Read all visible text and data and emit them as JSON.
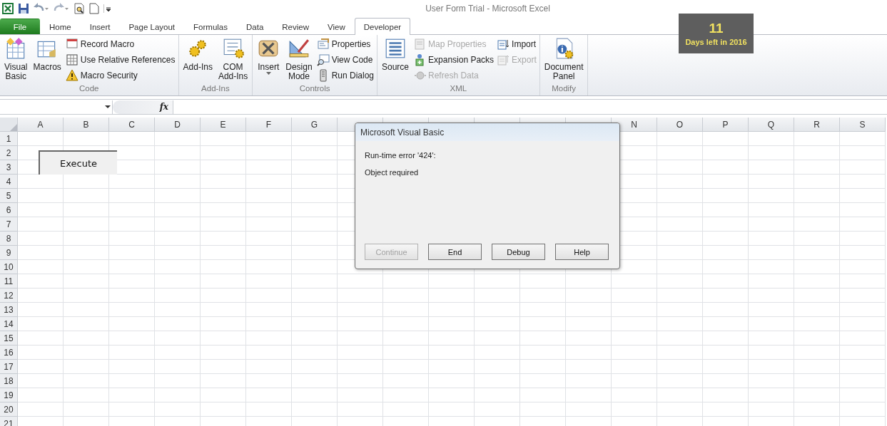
{
  "window": {
    "title": "User Form Trial  -  Microsoft Excel"
  },
  "tabs": [
    {
      "label": "File",
      "kind": "file",
      "selected": false
    },
    {
      "label": "Home",
      "kind": "tab",
      "selected": false
    },
    {
      "label": "Insert",
      "kind": "tab",
      "selected": false
    },
    {
      "label": "Page Layout",
      "kind": "tab",
      "selected": false
    },
    {
      "label": "Formulas",
      "kind": "tab",
      "selected": false
    },
    {
      "label": "Data",
      "kind": "tab",
      "selected": false
    },
    {
      "label": "Review",
      "kind": "tab",
      "selected": false
    },
    {
      "label": "View",
      "kind": "tab",
      "selected": false
    },
    {
      "label": "Developer",
      "kind": "tab",
      "selected": true
    }
  ],
  "ribbon": [
    {
      "label": "Code",
      "items": [
        {
          "kind": "large",
          "label": "Visual\nBasic",
          "disabled": false
        },
        {
          "kind": "large",
          "label": "Macros",
          "disabled": false
        },
        {
          "kind": "small",
          "label": "Record Macro",
          "disabled": false
        },
        {
          "kind": "small",
          "label": "Use Relative References",
          "disabled": false
        },
        {
          "kind": "small",
          "label": "Macro Security",
          "disabled": false
        }
      ]
    },
    {
      "label": "Add-Ins",
      "items": [
        {
          "kind": "large",
          "label": "Add-Ins",
          "disabled": false
        },
        {
          "kind": "large",
          "label": "COM\nAdd-Ins",
          "disabled": false
        }
      ]
    },
    {
      "label": "Controls",
      "items": [
        {
          "kind": "menu",
          "label": "Insert",
          "disabled": false
        },
        {
          "kind": "large",
          "label": "Design\nMode",
          "disabled": false
        },
        {
          "kind": "small",
          "label": "Properties",
          "disabled": false
        },
        {
          "kind": "small",
          "label": "View Code",
          "disabled": false
        },
        {
          "kind": "small",
          "label": "Run Dialog",
          "disabled": false
        }
      ]
    },
    {
      "label": "XML",
      "items": [
        {
          "kind": "large",
          "label": "Source",
          "disabled": false
        },
        {
          "kind": "small",
          "label": "Map Properties",
          "disabled": true
        },
        {
          "kind": "small",
          "label": "Expansion Packs",
          "disabled": false
        },
        {
          "kind": "small",
          "label": "Refresh Data",
          "disabled": true
        },
        {
          "kind": "small",
          "label": "Import",
          "disabled": false
        },
        {
          "kind": "small",
          "label": "Export",
          "disabled": true
        }
      ]
    },
    {
      "label": "Modify",
      "items": [
        {
          "kind": "large",
          "label": "Document\nPanel",
          "disabled": false
        }
      ]
    }
  ],
  "overlay_badge": {
    "number": "11",
    "caption": "Days left in 2016"
  },
  "formula_bar": {
    "function_label": "fx"
  },
  "sheet": {
    "columns": [
      {
        "kind": "label",
        "label": "A"
      },
      {
        "kind": "label",
        "label": "B"
      },
      {
        "kind": "label",
        "label": "C"
      },
      {
        "kind": "label",
        "label": "D"
      },
      {
        "kind": "label",
        "label": "E"
      },
      {
        "kind": "label",
        "label": "F"
      },
      {
        "kind": "label",
        "label": "G"
      },
      {
        "kind": "covered"
      },
      {
        "kind": "covered"
      },
      {
        "kind": "covered"
      },
      {
        "kind": "covered"
      },
      {
        "kind": "covered"
      },
      {
        "kind": "covered"
      },
      {
        "kind": "label",
        "label": "N"
      },
      {
        "kind": "label",
        "label": "O"
      },
      {
        "kind": "label",
        "label": "P"
      },
      {
        "kind": "label",
        "label": "Q"
      },
      {
        "kind": "label",
        "label": "R"
      },
      {
        "kind": "label",
        "label": "S"
      }
    ],
    "rows": [
      "1",
      "2",
      "3",
      "4",
      "5",
      "6",
      "7",
      "8",
      "9",
      "10",
      "11",
      "12",
      "13",
      "14",
      "15",
      "16",
      "17",
      "18",
      "19",
      "20",
      "21"
    ],
    "form_button": {
      "label": "Execute"
    }
  },
  "dialog": {
    "title": "Microsoft Visual Basic",
    "error": "Run-time error '424':",
    "message": "Object required",
    "buttons": [
      {
        "label": "Continue",
        "disabled": true
      },
      {
        "label": "End",
        "disabled": false
      },
      {
        "label": "Debug",
        "disabled": false
      },
      {
        "label": "Help",
        "disabled": false
      }
    ]
  }
}
